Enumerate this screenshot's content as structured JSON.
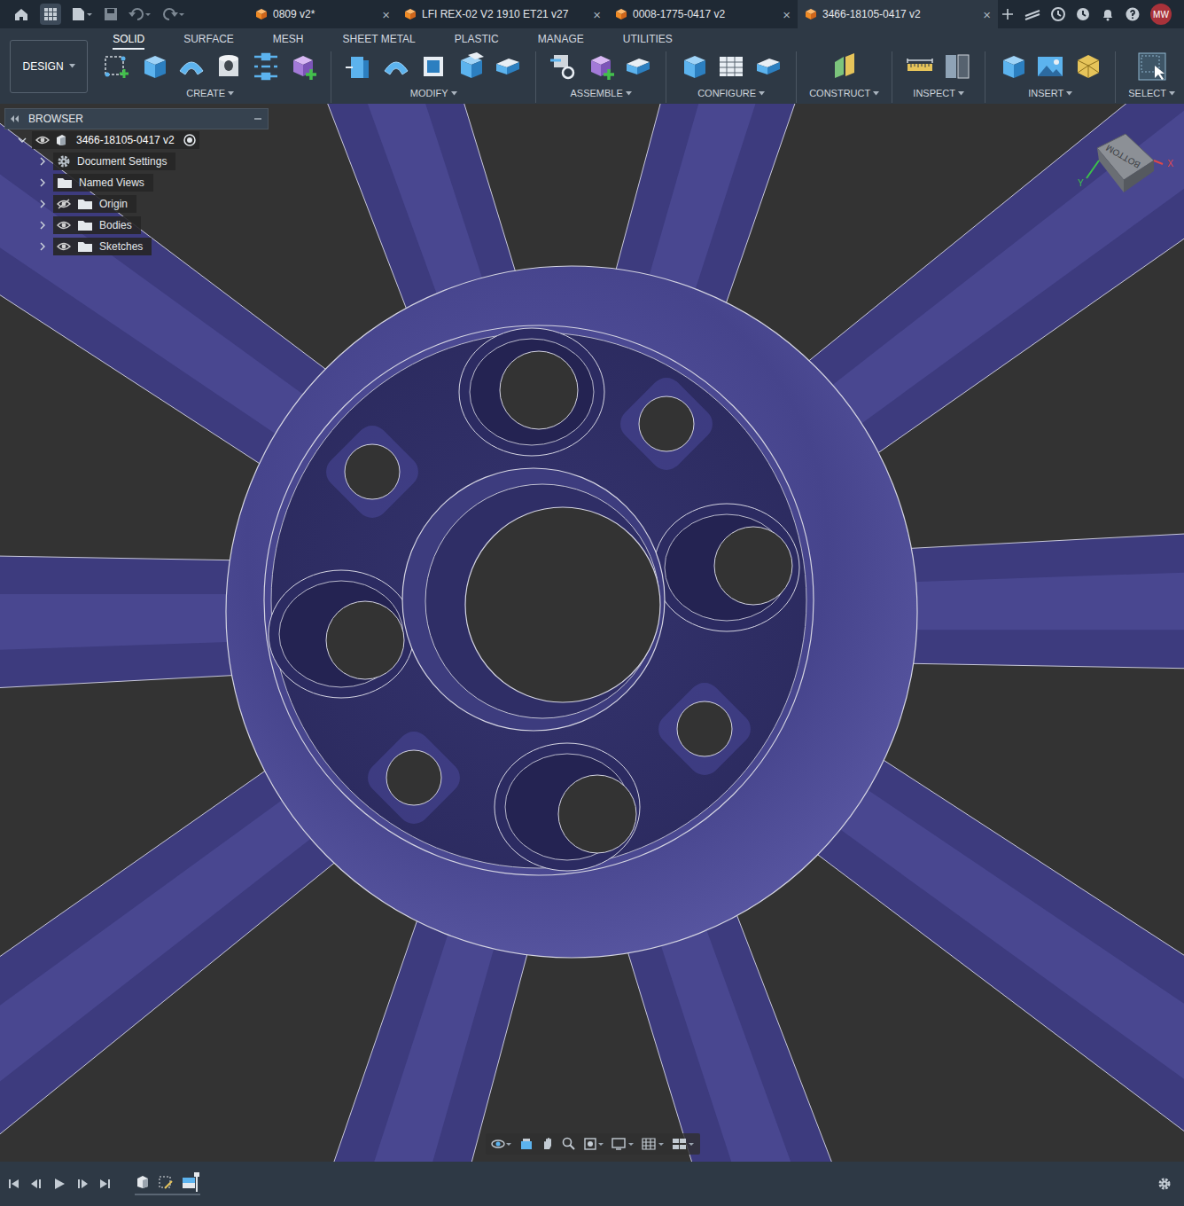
{
  "header": {
    "tabs": [
      {
        "label": "0809 v2*",
        "close": "×",
        "selected": false
      },
      {
        "label": "LFI REX-02 V2 1910 ET21 v27",
        "close": "×",
        "selected": false
      },
      {
        "label": "0008-1775-0417 v2",
        "close": "×",
        "selected": false
      },
      {
        "label": "3466-18105-0417 v2",
        "close": "×",
        "selected": true
      }
    ],
    "avatar": "MW"
  },
  "toolbar": {
    "workspace": "DESIGN",
    "workspace_tabs": [
      {
        "label": "SOLID",
        "selected": true
      },
      {
        "label": "SURFACE",
        "selected": false
      },
      {
        "label": "MESH",
        "selected": false
      },
      {
        "label": "SHEET METAL",
        "selected": false
      },
      {
        "label": "PLASTIC",
        "selected": false
      },
      {
        "label": "MANAGE",
        "selected": false
      },
      {
        "label": "UTILITIES",
        "selected": false
      }
    ],
    "groups": [
      "CREATE",
      "MODIFY",
      "ASSEMBLE",
      "CONFIGURE",
      "CONSTRUCT",
      "INSPECT",
      "INSERT",
      "SELECT"
    ]
  },
  "browser": {
    "title": "BROWSER",
    "root": {
      "label": "3466-18105-0417 v2",
      "expanded": true,
      "visible": true
    },
    "items": [
      {
        "label": "Document Settings",
        "kind": "settings",
        "visibility": "none",
        "expanded": false
      },
      {
        "label": "Named Views",
        "kind": "folder",
        "visibility": "none",
        "expanded": false
      },
      {
        "label": "Origin",
        "kind": "folder",
        "visibility": "hidden",
        "expanded": false
      },
      {
        "label": "Bodies",
        "kind": "folder",
        "visibility": "shown",
        "expanded": false
      },
      {
        "label": "Sketches",
        "kind": "folder",
        "visibility": "shown",
        "expanded": false
      }
    ]
  },
  "view_cube": {
    "face": "BOTTOM",
    "axes": [
      {
        "label": "X",
        "color": "#e04848"
      },
      {
        "label": "Y",
        "color": "#3cc04a"
      }
    ]
  }
}
